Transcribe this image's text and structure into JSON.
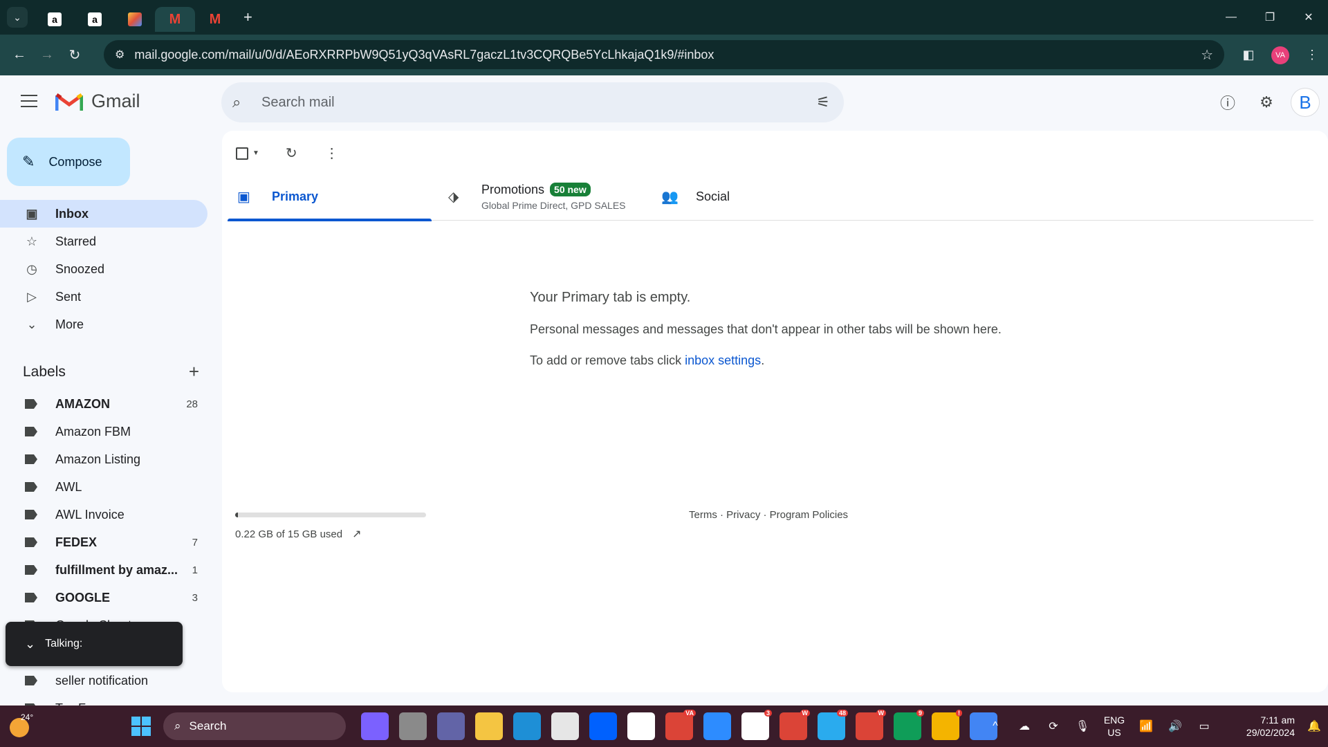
{
  "browser": {
    "tabs": [
      {
        "icon": "amazon-icon",
        "glyph": "a"
      },
      {
        "icon": "amazon-icon",
        "glyph": "a"
      },
      {
        "icon": "asana-icon",
        "glyph": ""
      },
      {
        "icon": "gmail-icon",
        "glyph": "M",
        "active": true
      },
      {
        "icon": "gmail-icon",
        "glyph": "M"
      }
    ],
    "url": "mail.google.com/mail/u/0/d/AEoRXRRPbW9Q51yQ3qVAsRL7gaczL1tv3CQRQBe5YcLhkajaQ1k9/#inbox",
    "profile_initials": "VA"
  },
  "header": {
    "app_name": "Gmail",
    "search_placeholder": "Search mail",
    "avatar_initial": "B"
  },
  "sidebar": {
    "compose_label": "Compose",
    "nav": [
      {
        "label": "Inbox",
        "icon": "inbox-icon",
        "active": true
      },
      {
        "label": "Starred",
        "icon": "star-icon"
      },
      {
        "label": "Snoozed",
        "icon": "clock-icon"
      },
      {
        "label": "Sent",
        "icon": "send-icon"
      },
      {
        "label": "More",
        "icon": "chevron-down-icon"
      }
    ],
    "labels_title": "Labels",
    "labels": [
      {
        "name": "AMAZON",
        "count": "28",
        "bold": true
      },
      {
        "name": "Amazon FBM",
        "count": ""
      },
      {
        "name": "Amazon Listing",
        "count": ""
      },
      {
        "name": "AWL",
        "count": ""
      },
      {
        "name": "AWL Invoice",
        "count": ""
      },
      {
        "name": "FEDEX",
        "count": "7",
        "bold": true
      },
      {
        "name": "fulfillment by amaz...",
        "count": "1",
        "bold": true
      },
      {
        "name": "GOOGLE",
        "count": "3",
        "bold": true
      },
      {
        "name": "Google Sheets",
        "count": ""
      },
      {
        "name": "",
        "count": ""
      },
      {
        "name": "seller notification",
        "count": ""
      },
      {
        "name": "Tax Forms",
        "count": ""
      }
    ]
  },
  "talking_popup": {
    "label": "Talking:"
  },
  "main": {
    "tabs": {
      "primary": "Primary",
      "promotions": "Promotions",
      "promotions_badge": "50 new",
      "promotions_sub": "Global Prime Direct, GPD SALES",
      "social": "Social"
    },
    "empty": {
      "title": "Your Primary tab is empty.",
      "line1": "Personal messages and messages that don't appear in other tabs will be shown here.",
      "line2_prefix": "To add or remove tabs click ",
      "line2_link": "inbox settings",
      "line2_suffix": "."
    },
    "storage": {
      "text": "0.22 GB of 15 GB used",
      "fraction": 0.015
    },
    "footer": "Terms · Privacy · Program Policies"
  },
  "taskbar": {
    "temperature": "24°",
    "search_label": "Search",
    "apps": [
      {
        "icon": "copilot-icon",
        "color": "#7b61ff",
        "badge": ""
      },
      {
        "icon": "task-view-icon",
        "color": "#8a8a8a",
        "badge": ""
      },
      {
        "icon": "teams-chat-icon",
        "color": "#6264a7",
        "badge": ""
      },
      {
        "icon": "file-explorer-icon",
        "color": "#f4c542",
        "badge": ""
      },
      {
        "icon": "edge-icon",
        "color": "#1e8fd6",
        "badge": ""
      },
      {
        "icon": "microsoft-store-icon",
        "color": "#e6e6e6",
        "badge": ""
      },
      {
        "icon": "dropbox-icon",
        "color": "#0061fe",
        "badge": ""
      },
      {
        "icon": "amazon-icon",
        "color": "#ffffff",
        "badge": ""
      },
      {
        "icon": "chrome-icon",
        "color": "#db4437",
        "badge": "VA"
      },
      {
        "icon": "zoom-icon",
        "color": "#2d8cff",
        "badge": ""
      },
      {
        "icon": "slack-icon",
        "color": "#ffffff",
        "badge": "3"
      },
      {
        "icon": "chrome-icon",
        "color": "#db4437",
        "badge": "W"
      },
      {
        "icon": "telegram-icon",
        "color": "#2aabee",
        "badge": "48"
      },
      {
        "icon": "chrome-icon",
        "color": "#db4437",
        "badge": "W"
      },
      {
        "icon": "chrome-icon",
        "color": "#0f9d58",
        "badge": "9"
      },
      {
        "icon": "chrome-icon",
        "color": "#f4b400",
        "badge": "!"
      },
      {
        "icon": "chrome-icon",
        "color": "#4285f4",
        "badge": ""
      }
    ],
    "language": "ENG",
    "region": "US",
    "time": "7:11 am",
    "date": "29/02/2024"
  }
}
